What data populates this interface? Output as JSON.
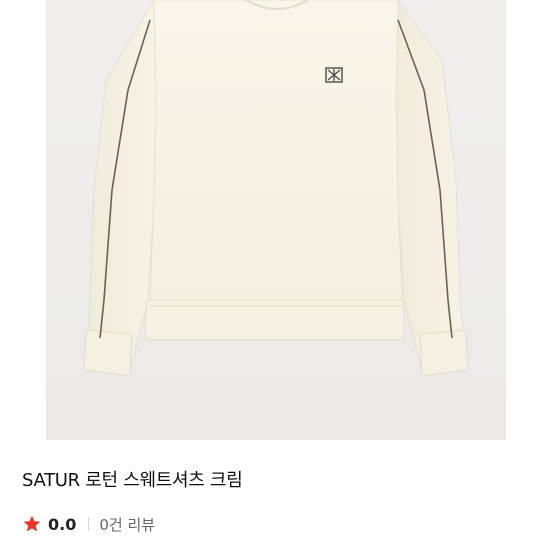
{
  "product": {
    "title": "SATUR 로턴 스웨트셔츠 크림",
    "rating": "0.0",
    "review_count": "0건 리뷰",
    "image_alt_icon": "sweatshirt-image"
  },
  "colors": {
    "star": "#e8362f",
    "garment": "#f7f4e8",
    "background": "#ecebe9",
    "piping": "#6b6255"
  }
}
